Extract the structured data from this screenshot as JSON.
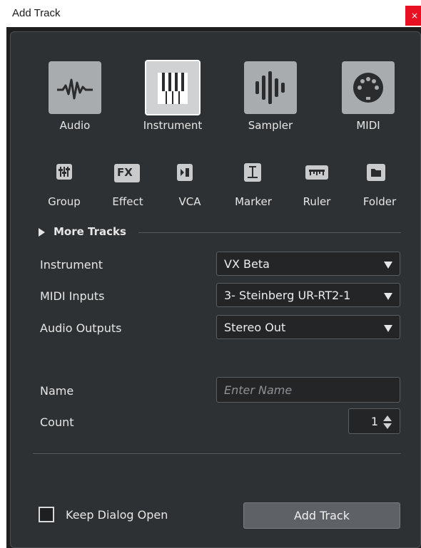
{
  "window": {
    "title": "Add Track",
    "close_label": "×"
  },
  "track_types": [
    {
      "label": "Audio",
      "icon": "audio-waveform-icon",
      "selected": false
    },
    {
      "label": "Instrument",
      "icon": "piano-keys-icon",
      "selected": true
    },
    {
      "label": "Sampler",
      "icon": "sampler-bars-icon",
      "selected": false
    },
    {
      "label": "MIDI",
      "icon": "midi-din-icon",
      "selected": false
    }
  ],
  "secondary_types": [
    {
      "label": "Group",
      "icon": "group-faders-icon"
    },
    {
      "label": "Effect",
      "icon": "fx-icon",
      "glyph": "FX"
    },
    {
      "label": "VCA",
      "icon": "vca-icon"
    },
    {
      "label": "Marker",
      "icon": "marker-icon"
    },
    {
      "label": "Ruler",
      "icon": "ruler-icon"
    },
    {
      "label": "Folder",
      "icon": "folder-icon"
    }
  ],
  "more_tracks": {
    "label": "More Tracks",
    "icon": "expand-triangle-right-icon"
  },
  "settings": {
    "instrument": {
      "label": "Instrument",
      "value": "VX Beta"
    },
    "midi_inputs": {
      "label": "MIDI Inputs",
      "value": "3- Steinberg UR-RT2-1"
    },
    "audio_outputs": {
      "label": "Audio Outputs",
      "value": "Stereo Out"
    },
    "name": {
      "label": "Name",
      "value": "",
      "placeholder": "Enter Name"
    },
    "count": {
      "label": "Count",
      "value": "1"
    }
  },
  "footer": {
    "keep_open_label": "Keep Dialog Open",
    "keep_open_checked": false,
    "add_button_label": "Add Track"
  },
  "colors": {
    "panel_bg": "#2e3133",
    "tile_bg": "#a9acaf",
    "tile_selected_border": "#ffffff",
    "close_button": "#e81123"
  }
}
